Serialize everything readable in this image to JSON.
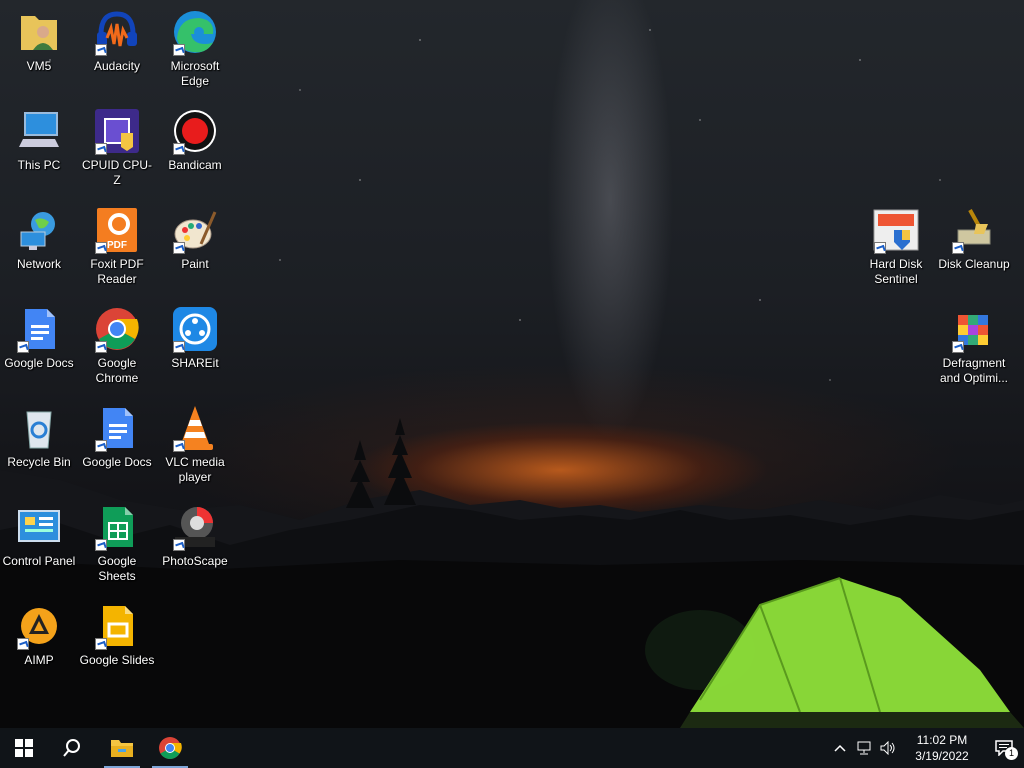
{
  "desktop": {
    "icons": [
      {
        "id": "vm5",
        "label": "VM5",
        "icon": "folder-user-icon",
        "shortcut": false
      },
      {
        "id": "audacity",
        "label": "Audacity",
        "icon": "audacity-icon",
        "shortcut": true
      },
      {
        "id": "edge",
        "label": "Microsoft Edge",
        "icon": "edge-icon",
        "shortcut": true
      },
      {
        "id": "this-pc",
        "label": "This PC",
        "icon": "computer-icon",
        "shortcut": false
      },
      {
        "id": "cpuz",
        "label": "CPUID CPU-Z",
        "icon": "cpu-z-icon",
        "shortcut": true
      },
      {
        "id": "bandicam",
        "label": "Bandicam",
        "icon": "bandicam-icon",
        "shortcut": true
      },
      {
        "id": "network",
        "label": "Network",
        "icon": "network-icon",
        "shortcut": false
      },
      {
        "id": "foxit",
        "label": "Foxit PDF Reader",
        "icon": "foxit-pdf-icon",
        "shortcut": true
      },
      {
        "id": "paint",
        "label": "Paint",
        "icon": "paint-icon",
        "shortcut": true
      },
      {
        "id": "gdocs1",
        "label": "Google Docs",
        "icon": "google-docs-icon",
        "shortcut": true
      },
      {
        "id": "chrome",
        "label": "Google Chrome",
        "icon": "chrome-icon",
        "shortcut": true
      },
      {
        "id": "shareit",
        "label": "SHAREit",
        "icon": "shareit-icon",
        "shortcut": true
      },
      {
        "id": "recycle",
        "label": "Recycle Bin",
        "icon": "recycle-bin-icon",
        "shortcut": false
      },
      {
        "id": "gdocs2",
        "label": "Google Docs",
        "icon": "google-docs-icon",
        "shortcut": true
      },
      {
        "id": "vlc",
        "label": "VLC media player",
        "icon": "vlc-icon",
        "shortcut": true
      },
      {
        "id": "control",
        "label": "Control Panel",
        "icon": "control-panel-icon",
        "shortcut": false
      },
      {
        "id": "gsheets",
        "label": "Google Sheets",
        "icon": "google-sheets-icon",
        "shortcut": true
      },
      {
        "id": "photoscape",
        "label": "PhotoScape",
        "icon": "photoscape-icon",
        "shortcut": true
      },
      {
        "id": "aimp",
        "label": "AIMP",
        "icon": "aimp-icon",
        "shortcut": true
      },
      {
        "id": "gslides",
        "label": "Google Slides",
        "icon": "google-slides-icon",
        "shortcut": true
      },
      {
        "id": "hds",
        "label": "Hard Disk Sentinel",
        "icon": "hard-disk-sentinel-icon",
        "shortcut": true
      },
      {
        "id": "cleanup",
        "label": "Disk Cleanup",
        "icon": "disk-cleanup-icon",
        "shortcut": true
      },
      {
        "id": "defrag",
        "label": "Defragment and Optimi...",
        "icon": "defragment-icon",
        "shortcut": true
      }
    ]
  },
  "taskbar": {
    "start_icon": "windows-start-icon",
    "search_icon": "search-icon",
    "pinned": [
      {
        "name": "file-explorer",
        "icon": "file-explorer-icon"
      },
      {
        "name": "google-chrome",
        "icon": "chrome-icon"
      }
    ],
    "tray": {
      "time": "11:02 PM",
      "date": "3/19/2022",
      "notification_count": "1"
    }
  },
  "colors": {
    "taskbar_bg": "#101418",
    "accent": "#7ea6d8",
    "tent_green": "#8fe23a"
  }
}
